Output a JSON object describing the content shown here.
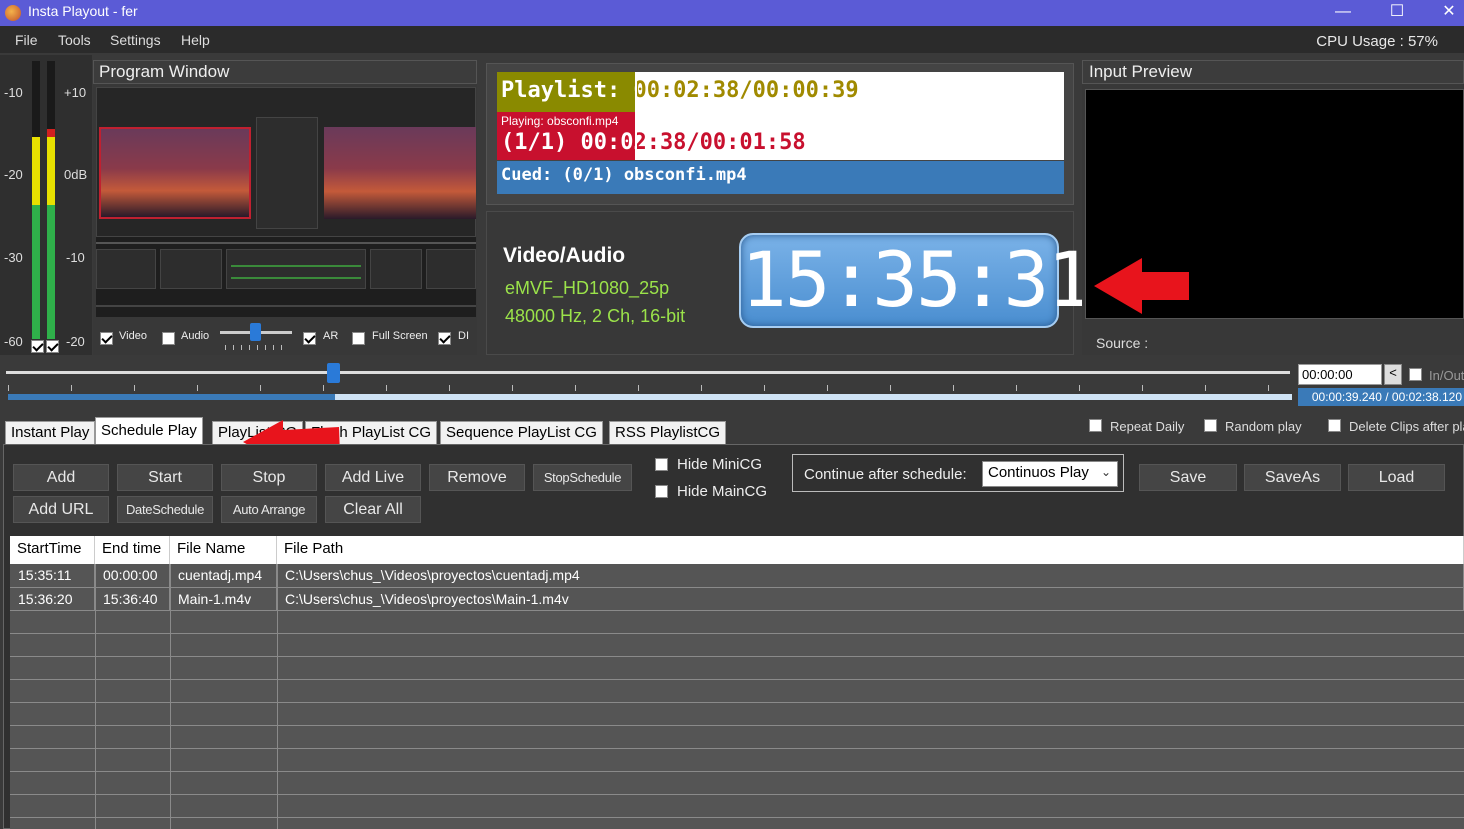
{
  "window": {
    "title": "Insta Playout - fer",
    "minimize": "—",
    "maximize": "☐",
    "close": "✕"
  },
  "menu": [
    "File",
    "Tools",
    "Settings",
    "Help"
  ],
  "cpu_usage": "CPU Usage : 57%",
  "meter_labels": {
    "l1": "-10",
    "l2": "-20",
    "l3": "-30",
    "l4": "-60",
    "r1": "+10",
    "r2": "0dB",
    "r3": "-10",
    "r4": "-20"
  },
  "program_window": {
    "title": "Program Window",
    "controls": {
      "video": "Video",
      "audio": "Audio",
      "ar": "AR",
      "fullscreen": "Full Screen",
      "di": "DI"
    }
  },
  "playlist_info": {
    "line1": "Playlist: 00:02:38/00:00:39",
    "playing": "Playing: obsconfi.mp4",
    "line2": "(1/1) 00:02:38/00:01:58",
    "cued": "Cued: (0/1) obsconfi.mp4"
  },
  "video_audio": {
    "title": "Video/Audio",
    "format": "eMVF_HD1080_25p",
    "audio": "48000 Hz, 2 Ch, 16-bit",
    "clock": "15:35:31"
  },
  "input_preview": {
    "title": "Input Preview",
    "source": "Source :"
  },
  "seek": {
    "time": "00:00:00",
    "back": "<",
    "inout": "In/Out",
    "duration": "00:00:39.240 / 00:02:38.120",
    "progress": 0.255
  },
  "tabs": [
    "Instant Play",
    "Schedule Play",
    "PlayList CG",
    "Flash PlayList CG",
    "Sequence PlayList CG",
    "RSS PlaylistCG"
  ],
  "options": {
    "repeat_daily": "Repeat Daily",
    "random_play": "Random play",
    "delete_clips": "Delete Clips after play"
  },
  "buttons": {
    "add": "Add",
    "start": "Start",
    "stop": "Stop",
    "add_live": "Add Live",
    "remove": "Remove",
    "stop_schedule": "StopSchedule",
    "add_url": "Add URL",
    "date_schedule": "DateSchedule",
    "auto_arrange": "Auto Arrange",
    "clear_all": "Clear All",
    "save": "Save",
    "save_as": "SaveAs",
    "load": "Load"
  },
  "checks": {
    "hide_minicg": "Hide MiniCG",
    "hide_maincg": "Hide MainCG"
  },
  "continue": {
    "label": "Continue after schedule:",
    "value": "Continuos Play"
  },
  "table": {
    "headers": [
      "StartTime",
      "End time",
      "File Name",
      "File Path"
    ],
    "rows": [
      [
        "15:35:11",
        "00:00:00",
        "cuentadj.mp4",
        "C:\\Users\\chus_\\Videos\\proyectos\\cuentadj.mp4"
      ],
      [
        "15:36:20",
        "15:36:40",
        "Main-1.m4v",
        "C:\\Users\\chus_\\Videos\\proyectos\\Main-1.m4v"
      ]
    ]
  },
  "colors": {
    "titlebar": "#5b5bd6",
    "accent_blue": "#3a7ab8",
    "playing_red": "#c8102e",
    "playlist_olive": "#8a8a00",
    "va_green": "#9be34a",
    "arrow_red": "#e8141c"
  }
}
